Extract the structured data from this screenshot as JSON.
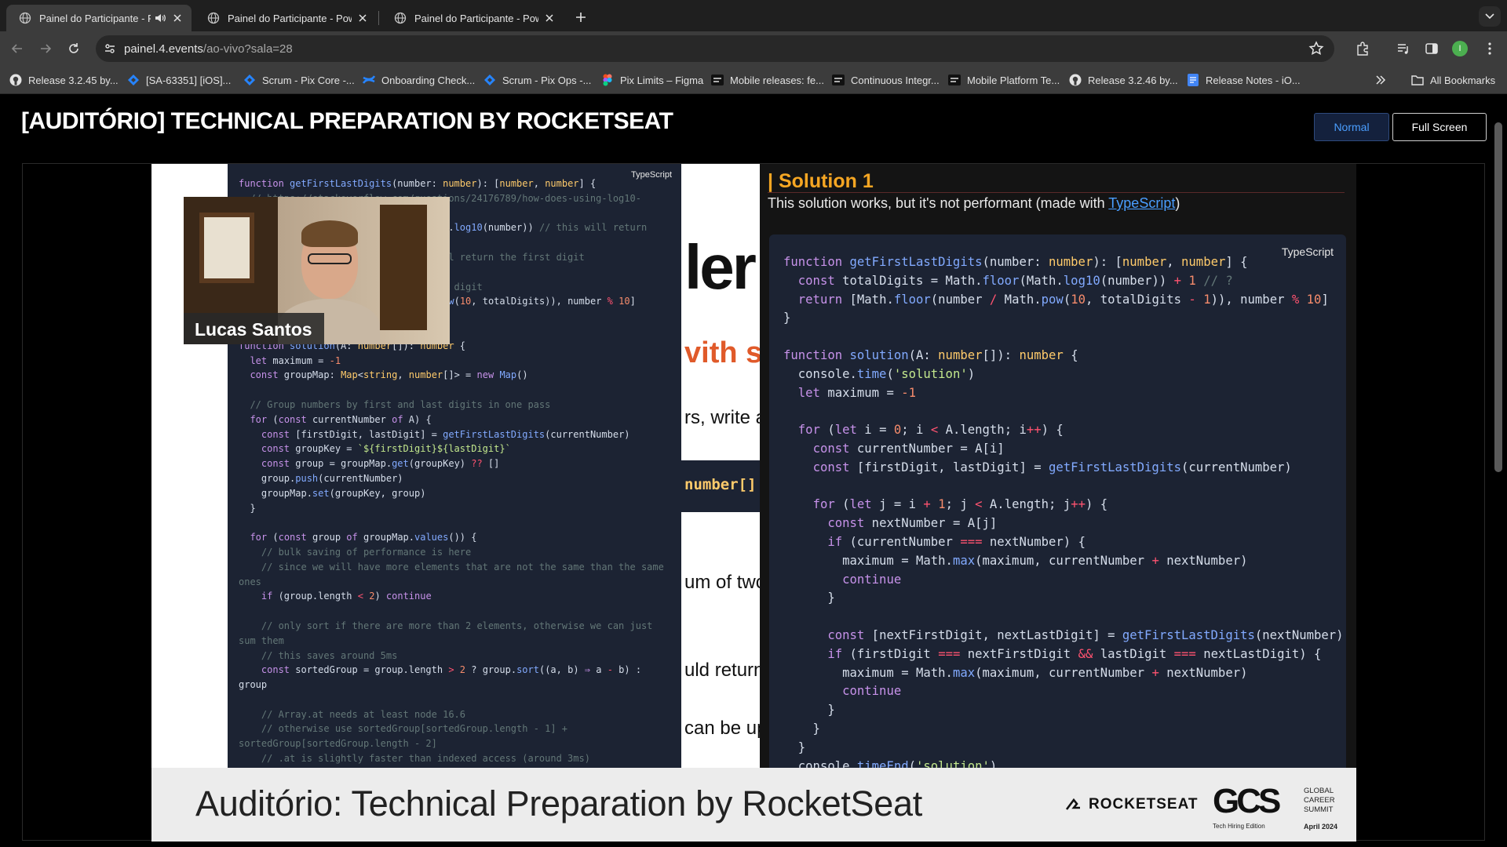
{
  "browser": {
    "tabs": [
      {
        "title": "Painel do Participante - Pe",
        "active": true,
        "audio": true
      },
      {
        "title": "Painel do Participante - Powe",
        "active": false,
        "audio": false
      },
      {
        "title": "Painel do Participante - Powe",
        "active": false,
        "audio": false
      }
    ],
    "url": {
      "host": "painel.4.events",
      "path": "/ao-vivo?sala=28"
    },
    "profile_initial": "I",
    "bookmarks": [
      {
        "label": "Release 3.2.45 by...",
        "icon": "github-icon"
      },
      {
        "label": "[SA-63351] [iOS]...",
        "icon": "jira-icon"
      },
      {
        "label": "Scrum - Pix Core -...",
        "icon": "jira-icon"
      },
      {
        "label": "Onboarding Check...",
        "icon": "confluence-icon"
      },
      {
        "label": "Scrum - Pix Ops -...",
        "icon": "jira-icon"
      },
      {
        "label": "Pix Limits – Figma",
        "icon": "figma-icon"
      },
      {
        "label": "Mobile releases: fe...",
        "icon": "app-icon"
      },
      {
        "label": "Continuous Integr...",
        "icon": "app-icon"
      },
      {
        "label": "Mobile Platform Te...",
        "icon": "app-icon"
      },
      {
        "label": "Release 3.2.46 by...",
        "icon": "github-icon"
      },
      {
        "label": "Release Notes - iO...",
        "icon": "docs-icon"
      }
    ],
    "all_bookmarks_label": "All Bookmarks"
  },
  "page": {
    "title": "[AUDITÓRIO] TECHNICAL PREPARATION BY ROCKETSEAT",
    "normal_button": "Normal",
    "fullscreen_button": "Full Screen"
  },
  "video": {
    "left_code_lang": "TypeScript",
    "slide_fragments": [
      "ler",
      "vith sai",
      "rs, write a",
      "number[]",
      "um of twc",
      "uld return",
      "can be up"
    ],
    "solution": {
      "heading": "| Solution 1",
      "subtitle_pre": "This solution works, but it's not performant (made with ",
      "subtitle_link": "TypeScript",
      "subtitle_post": ")",
      "code_lang": "TypeScript"
    },
    "speaker_name": "Lucas Santos",
    "banner_title": "Auditório: Technical Preparation by RocketSeat",
    "sponsor_logo": "ROCKETSEAT",
    "event_logo": {
      "mark": "GCS",
      "words": "GLOBAL\nCAREER\nSUMMIT",
      "edition": "Tech Hiring Edition",
      "date": "April 2024"
    }
  }
}
